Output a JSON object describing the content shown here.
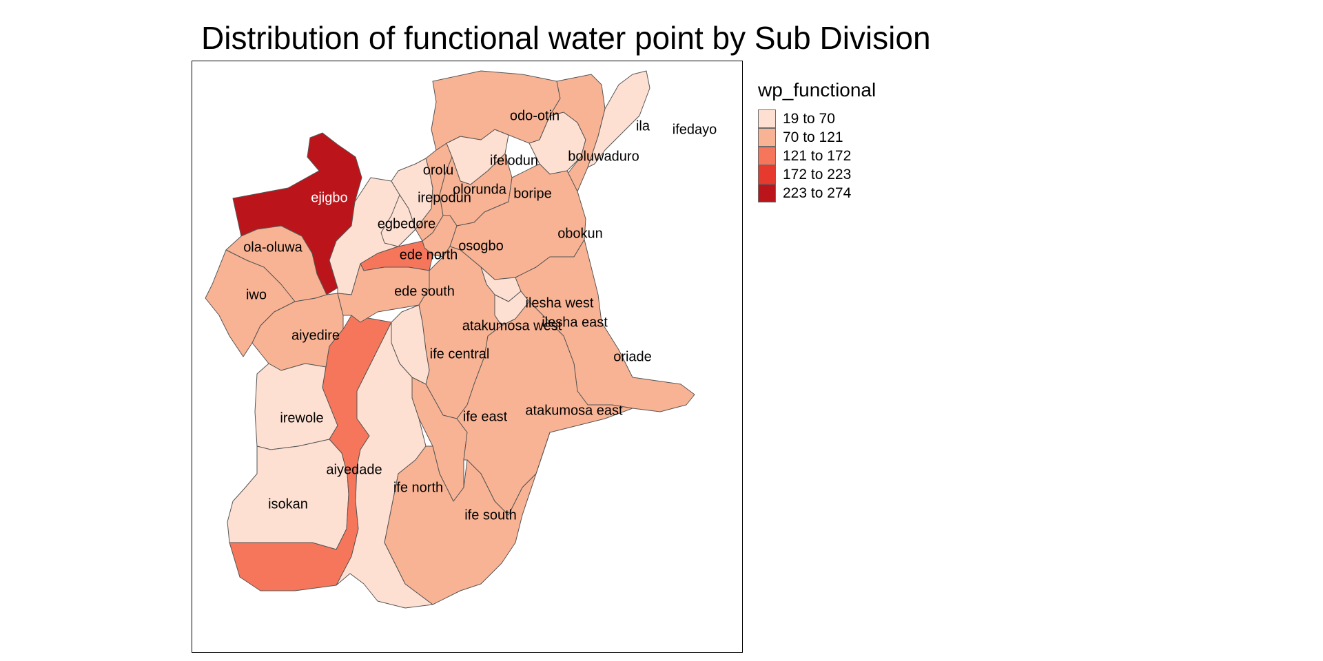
{
  "title": "Distribution of functional water point by Sub Division",
  "legend": {
    "title": "wp_functional",
    "classes": [
      {
        "label": "19 to 70",
        "color": "#fde0d2"
      },
      {
        "label": "70 to 121",
        "color": "#f8b394"
      },
      {
        "label": "121 to 172",
        "color": "#f6765b"
      },
      {
        "label": "172 to 223",
        "color": "#e53a2d"
      },
      {
        "label": "223 to 274",
        "color": "#bb151b"
      }
    ]
  },
  "regions": [
    {
      "name": "ejigbo",
      "class": 4
    },
    {
      "name": "ola-oluwa",
      "class": 1
    },
    {
      "name": "iwo",
      "class": 1
    },
    {
      "name": "aiyedire",
      "class": 1
    },
    {
      "name": "irewole",
      "class": 0
    },
    {
      "name": "isokan",
      "class": 0
    },
    {
      "name": "aiyedade",
      "class": 2
    },
    {
      "name": "egbedore",
      "class": 0
    },
    {
      "name": "orolu",
      "class": 0
    },
    {
      "name": "irepodun",
      "class": 0
    },
    {
      "name": "olorunda",
      "class": 1
    },
    {
      "name": "ifelodun",
      "class": 0
    },
    {
      "name": "odo-otin",
      "class": 1
    },
    {
      "name": "boluwaduro",
      "class": 0
    },
    {
      "name": "ila",
      "class": 1
    },
    {
      "name": "ifedayo",
      "class": 0
    },
    {
      "name": "boripe",
      "class": 1
    },
    {
      "name": "osogbo",
      "class": 1
    },
    {
      "name": "ede north",
      "class": 2
    },
    {
      "name": "ede south",
      "class": 1
    },
    {
      "name": "obokun",
      "class": 1
    },
    {
      "name": "ilesha west",
      "class": 0
    },
    {
      "name": "ilesha east",
      "class": 0
    },
    {
      "name": "atakumosa west",
      "class": 1
    },
    {
      "name": "ife central",
      "class": 0
    },
    {
      "name": "oriade",
      "class": 1
    },
    {
      "name": "ife east",
      "class": 1
    },
    {
      "name": "atakumosa east",
      "class": 1
    },
    {
      "name": "ife north",
      "class": 0
    },
    {
      "name": "ife south",
      "class": 1
    }
  ]
}
